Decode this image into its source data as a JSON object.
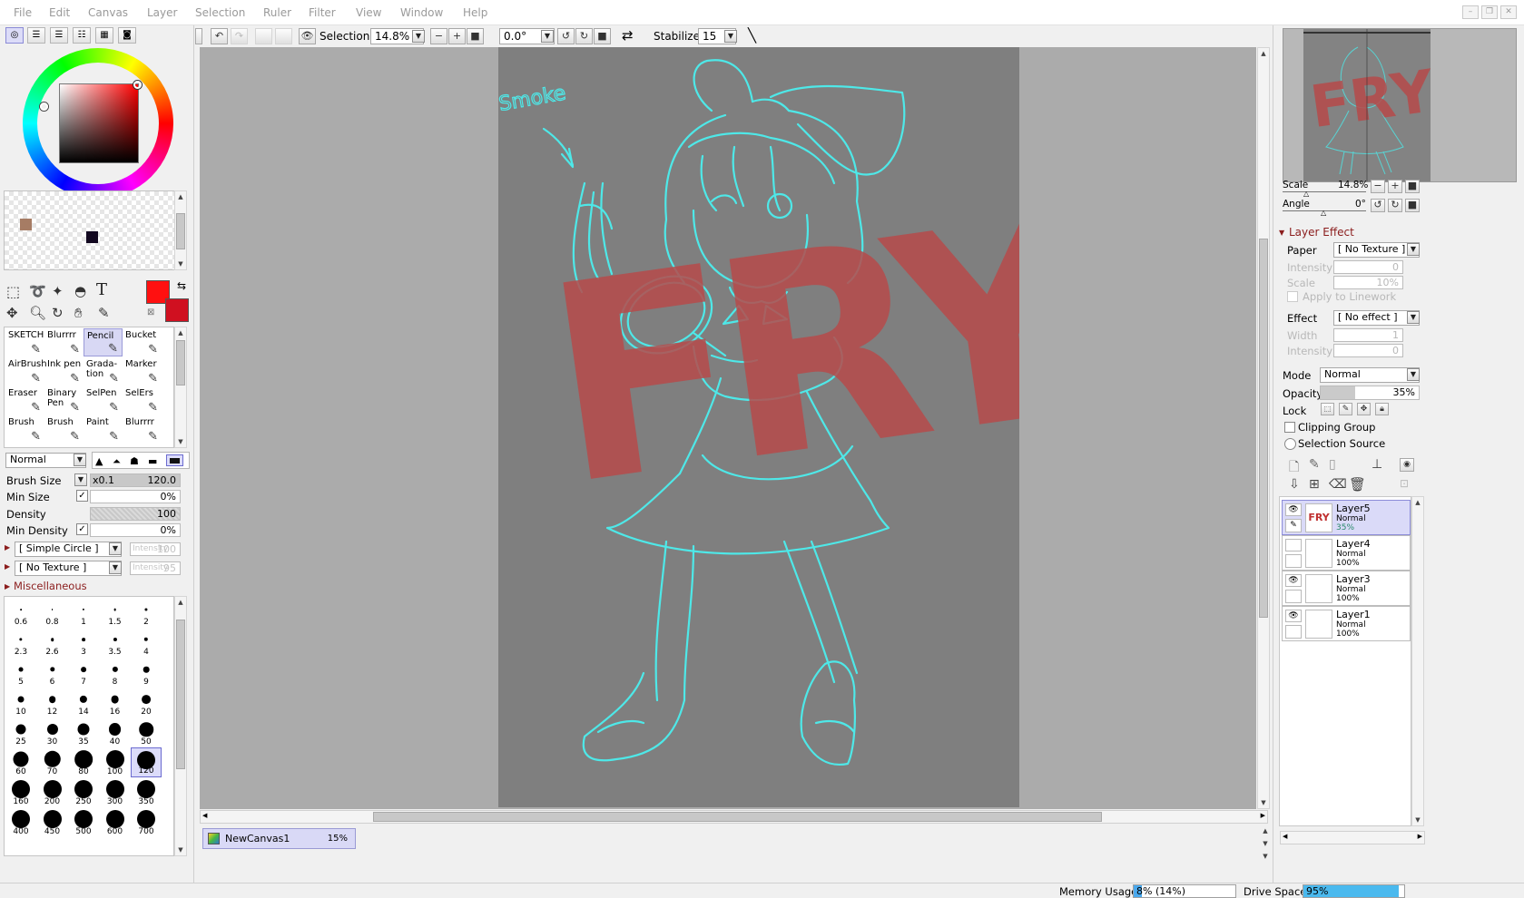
{
  "menu": [
    "File",
    "Edit",
    "Canvas",
    "Layer",
    "Selection",
    "Ruler",
    "Filter",
    "View",
    "Window",
    "Help"
  ],
  "colors": {
    "primary": "#ff1010",
    "secondary": "#d01020",
    "swatch1": "#a67c64",
    "swatch2": "#120820",
    "accent_select": "#d9d9f6",
    "section_header": "#8b1d1d",
    "line_art": "#4ee8e8",
    "watermark": "#b64a4a"
  },
  "toolbar": {
    "selection_label": "Selection",
    "zoom": "14.8%",
    "angle": "0.0°",
    "stabilizer_label": "Stabilizer",
    "stabilizer_value": "15"
  },
  "tools": [
    {
      "label": "SKETCH",
      "icon": "pen-icon"
    },
    {
      "label": "Blurrrr",
      "icon": "pen-icon"
    },
    {
      "label": "Pencil",
      "icon": "pencil-icon",
      "selected": true
    },
    {
      "label": "Bucket",
      "icon": "bucket-icon"
    },
    {
      "label": "AirBrush",
      "icon": "airbrush-icon"
    },
    {
      "label": "Ink pen",
      "icon": "pen-icon"
    },
    {
      "label": "Grada-\ntion",
      "icon": "gradient-icon"
    },
    {
      "label": "Marker",
      "icon": "marker-icon"
    },
    {
      "label": "Eraser",
      "icon": "eraser-icon"
    },
    {
      "label": "Binary\nPen",
      "icon": "pen-icon"
    },
    {
      "label": "SelPen",
      "icon": "selpen-icon"
    },
    {
      "label": "SelErs",
      "icon": "selers-icon"
    },
    {
      "label": "Brush",
      "icon": "brush-icon"
    },
    {
      "label": "Brush",
      "icon": "brush-icon"
    },
    {
      "label": "Paint",
      "icon": "brush-icon"
    },
    {
      "label": "Blurrrr",
      "icon": "brush-icon"
    }
  ],
  "brush": {
    "blend_mode": "Normal",
    "size_label": "Brush Size",
    "size_mult": "x0.1",
    "size_value": "120.0",
    "min_size_label": "Min Size",
    "min_size_value": "0%",
    "density_label": "Density",
    "density_value": "100",
    "min_density_label": "Min Density",
    "min_density_value": "0%",
    "shape": "[ Simple Circle ]",
    "shape_intensity": "Intensity",
    "shape_intensity_value": "100",
    "texture": "[ No Texture ]",
    "texture_intensity": "Intensity",
    "texture_intensity_value": "95",
    "misc_label": "Miscellaneous"
  },
  "dot_sizes": [
    [
      "0.6",
      "0.8",
      "1",
      "1.5",
      "2"
    ],
    [
      "2.3",
      "2.6",
      "3",
      "3.5",
      "4"
    ],
    [
      "5",
      "6",
      "7",
      "8",
      "9"
    ],
    [
      "10",
      "12",
      "14",
      "16",
      "20"
    ],
    [
      "25",
      "30",
      "35",
      "40",
      "50"
    ],
    [
      "60",
      "70",
      "80",
      "100",
      "120"
    ],
    [
      "160",
      "200",
      "250",
      "300",
      "350"
    ],
    [
      "400",
      "450",
      "500",
      "600",
      "700"
    ]
  ],
  "canvas": {
    "sketch_note": "Smoke",
    "watermark": "FRY"
  },
  "document_tab": {
    "name": "NewCanvas1",
    "zoom": "15%"
  },
  "navigator": {
    "scale_label": "Scale",
    "scale_value": "14.8%",
    "angle_label": "Angle",
    "angle_value": "0°"
  },
  "layer_effect": {
    "header": "Layer Effect",
    "paper_label": "Paper",
    "paper_value": "[ No Texture ]",
    "intensity_label": "Intensity",
    "intensity_value": "0",
    "scale_label": "Scale",
    "scale_value": "10%",
    "apply_linework": "Apply to Linework",
    "effect_label": "Effect",
    "effect_value": "[ No effect ]",
    "width_label": "Width",
    "width_value": "1",
    "effect_intensity_label": "Intensity",
    "effect_intensity_value": "0"
  },
  "layer_props": {
    "mode_label": "Mode",
    "mode_value": "Normal",
    "opacity_label": "Opacity",
    "opacity_value": "35%",
    "opacity_fraction": 0.35,
    "lock_label": "Lock",
    "clipping_group": "Clipping Group",
    "selection_source": "Selection Source"
  },
  "layers": [
    {
      "name": "Layer5",
      "mode": "Normal",
      "opacity": "35%",
      "visible": true,
      "selected": true,
      "thumb": "FRY"
    },
    {
      "name": "Layer4",
      "mode": "Normal",
      "opacity": "100%",
      "visible": false,
      "selected": false,
      "thumb": ""
    },
    {
      "name": "Layer3",
      "mode": "Normal",
      "opacity": "100%",
      "visible": true,
      "selected": false,
      "thumb": ""
    },
    {
      "name": "Layer1",
      "mode": "Normal",
      "opacity": "100%",
      "visible": true,
      "selected": false,
      "thumb": ""
    }
  ],
  "status": {
    "memory_label": "Memory Usage",
    "memory_value": "8% (14%)",
    "memory_fraction": 0.08,
    "drive_label": "Drive Space",
    "drive_value": "95%",
    "drive_fraction": 0.95
  }
}
